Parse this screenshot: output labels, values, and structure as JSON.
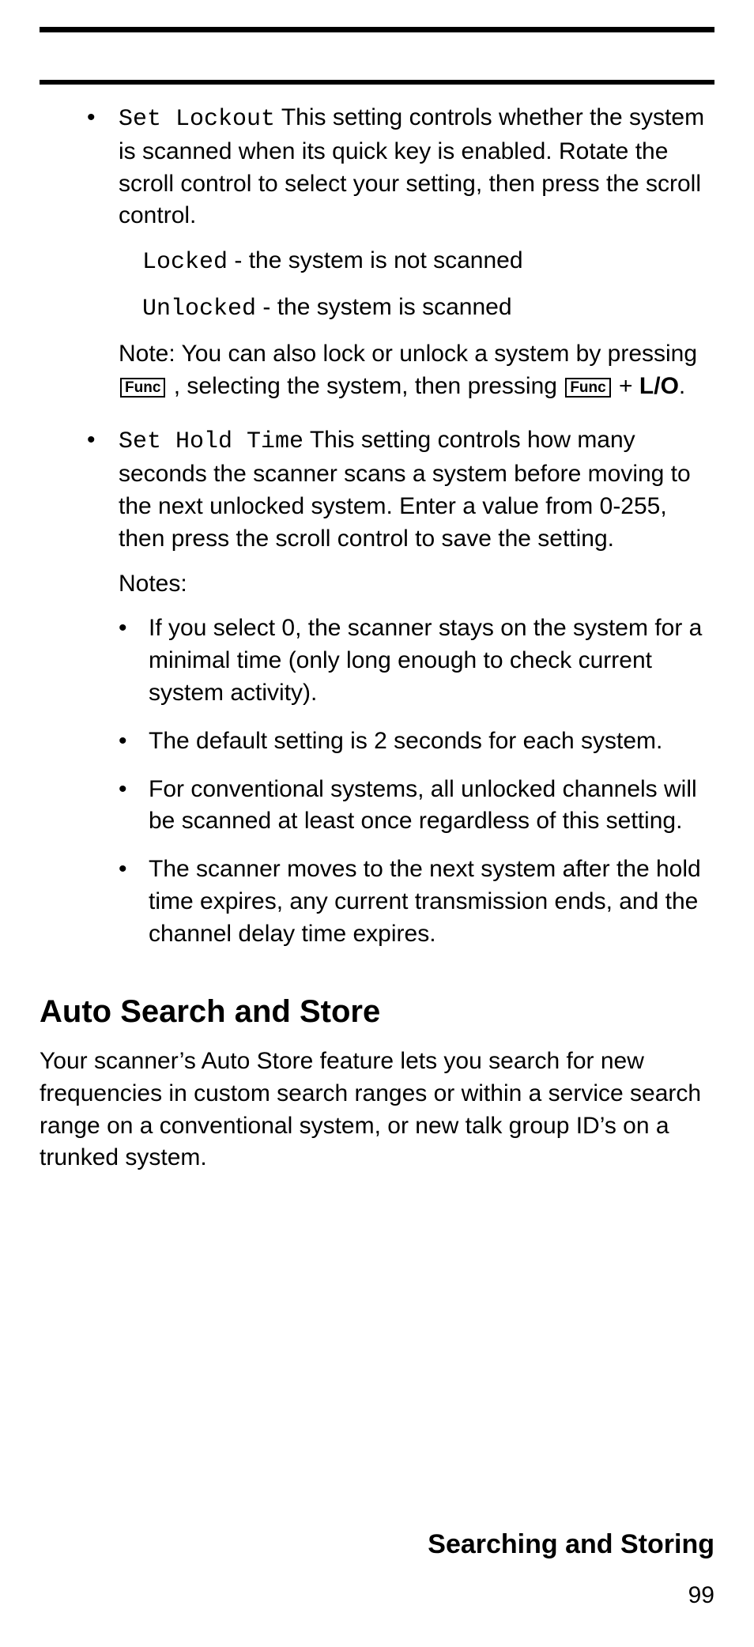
{
  "labels": {
    "set_lockout": "Set Lockout",
    "locked": "Locked",
    "unlocked": "Unlocked",
    "set_hold_time": "Set Hold Time",
    "func": "Func",
    "lo": "L/O",
    "notes_label": "Notes:"
  },
  "text": {
    "set_lockout_desc": " This setting controls whether the system is scanned when its quick key is enabled. Rotate the scroll control to select your setting, then press the scroll control.",
    "locked_desc": " - the system is not scanned",
    "unlocked_desc": " - the system is scanned",
    "note_prefix": "Note: You can also lock or unlock a system by pressing ",
    "note_mid": " , selecting the system, then pressing ",
    "note_plus": "  + ",
    "note_end": ".",
    "set_hold_time_desc": " This setting controls how many seconds the scanner scans a system before moving to the next unlocked system. Enter a value from 0-255, then press the scroll control to save the setting.",
    "hold_notes": [
      "If you select 0, the scanner stays on the system for a minimal time (only long enough to check current system activity).",
      "The default setting is 2 seconds for each system.",
      "For conventional systems, all unlocked channels will be scanned at least once regardless of this setting.",
      "The scanner moves to the next system after the hold time expires, any current transmission ends, and the channel delay time expires."
    ]
  },
  "section": {
    "title": "Auto Search and Store",
    "body": "Your scanner’s Auto Store feature lets you search for new frequencies in custom search ranges or within a service search range on a conventional system, or new talk group ID’s on a trunked system."
  },
  "footer": {
    "title": "Searching and Storing",
    "page": "99"
  }
}
